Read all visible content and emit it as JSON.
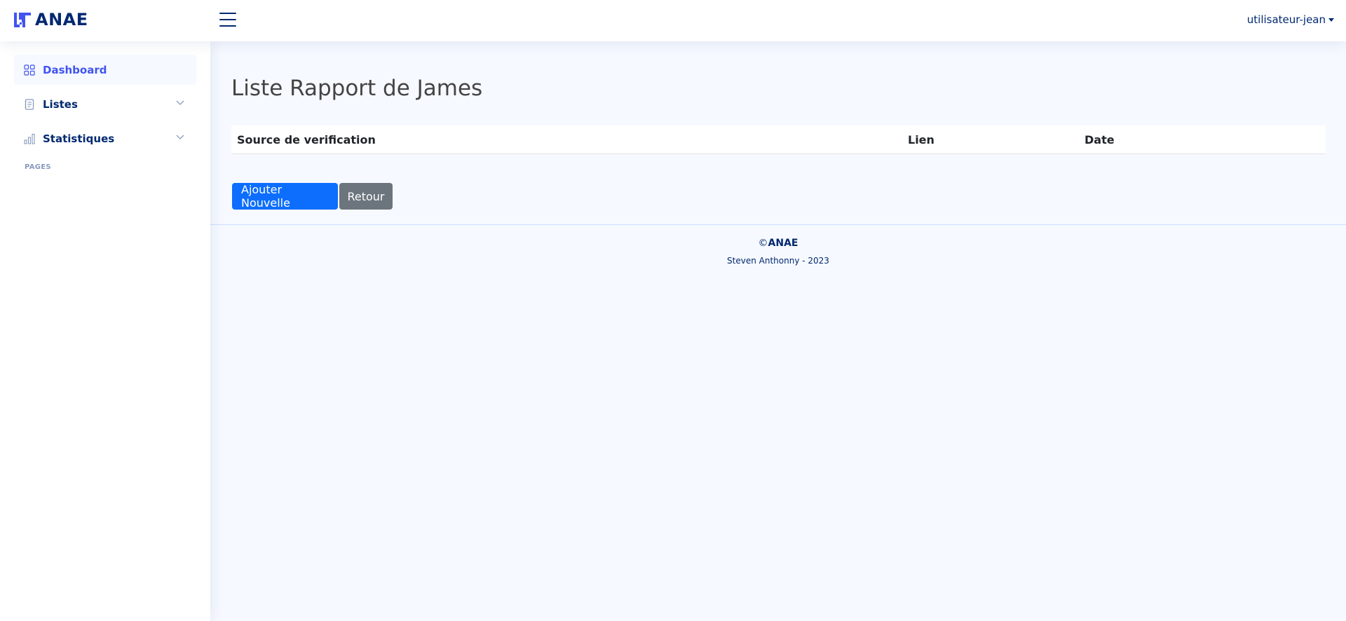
{
  "header": {
    "logo_text": "ANAE",
    "user_label": "utilisateur-jean"
  },
  "sidebar": {
    "items": [
      {
        "label": "Dashboard",
        "icon": "grid-icon",
        "active": true
      },
      {
        "label": "Listes",
        "icon": "journal-text-icon",
        "active": false,
        "expandable": true
      },
      {
        "label": "Statistiques",
        "icon": "bar-chart-icon",
        "active": false,
        "expandable": true
      }
    ],
    "heading": "PAGES"
  },
  "main": {
    "title": "Liste Rapport de James",
    "table": {
      "columns": [
        "Source de verification",
        "Lien",
        "Date"
      ],
      "rows": []
    },
    "buttons": {
      "add_label": "Ajouter Nouvelle",
      "back_label": "Retour"
    }
  },
  "footer": {
    "copyright_symbol": "©",
    "copyright_name": "ANAE",
    "credits": "Steven Anthonny - 2023"
  },
  "colors": {
    "brand": "#012970",
    "accent": "#4154f1",
    "primary_button": "#0d6efd",
    "secondary_button": "#6c757d",
    "background": "#f6f9ff"
  }
}
